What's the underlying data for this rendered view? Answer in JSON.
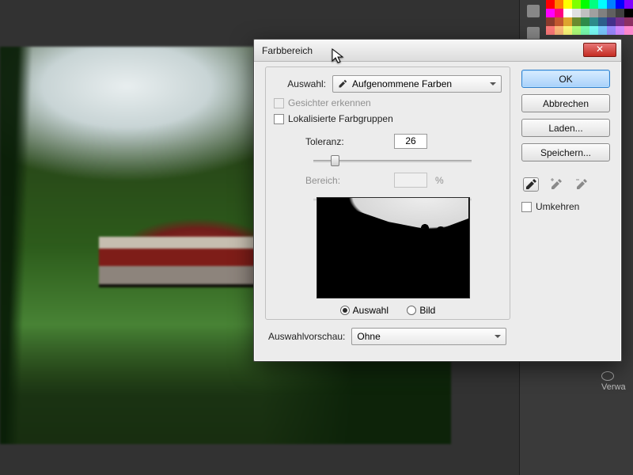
{
  "dialog": {
    "title": "Farbbereich",
    "select_label": "Auswahl:",
    "select_value": "Aufgenommene Farben",
    "detect_faces": "Gesichter erkennen",
    "localized": "Lokalisierte Farbgruppen",
    "tolerance_label": "Toleranz:",
    "tolerance_value": "26",
    "range_label": "Bereich:",
    "range_unit": "%",
    "radio_selection": "Auswahl",
    "radio_image": "Bild",
    "preview_label": "Auswahlvorschau:",
    "preview_value": "Ohne"
  },
  "buttons": {
    "ok": "OK",
    "cancel": "Abbrechen",
    "load": "Laden...",
    "save": "Speichern..."
  },
  "checkbox": {
    "invert": "Umkehren"
  },
  "status": {
    "verwa": "Verwa"
  },
  "swatches": [
    "#ff0000",
    "#ff8000",
    "#ffff00",
    "#80ff00",
    "#00ff00",
    "#00ff80",
    "#00ffff",
    "#0080ff",
    "#0000ff",
    "#8000ff",
    "#ff00ff",
    "#ff0080",
    "#ffffff",
    "#e0e0e0",
    "#c0c0c0",
    "#a0a0a0",
    "#808080",
    "#606060",
    "#404040",
    "#000000",
    "#8d3c2e",
    "#c4582f",
    "#e0a52e",
    "#6b8d2e",
    "#2e8d4a",
    "#2e8d8d",
    "#2e5f8d",
    "#44318d",
    "#7a318d",
    "#8d3163",
    "#ff7a7a",
    "#ffba7a",
    "#fffa7a",
    "#b0ff7a",
    "#7affb0",
    "#7afffa",
    "#7acaff",
    "#9a8aff",
    "#d58aff",
    "#ff8ad0"
  ]
}
